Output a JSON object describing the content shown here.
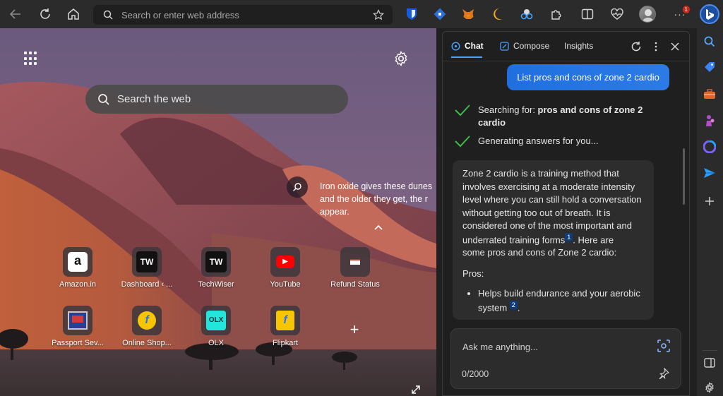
{
  "toolbar": {
    "address_placeholder": "Search or enter web address",
    "notification_count": "1"
  },
  "ntp": {
    "search_placeholder": "Search the web",
    "info_text": [
      "Iron oxide gives these dunes",
      "and the older they get, the r",
      "appear."
    ],
    "tiles": [
      {
        "label": "Amazon.in",
        "icon": "amazon-icon",
        "glyph": "a"
      },
      {
        "label": "Dashboard ‹ ...",
        "icon": "techwiser-icon",
        "glyph": "TW"
      },
      {
        "label": "TechWiser",
        "icon": "techwiser-icon",
        "glyph": "TW"
      },
      {
        "label": "YouTube",
        "icon": "youtube-icon",
        "glyph": "▶"
      },
      {
        "label": "Refund Status",
        "icon": "refund-icon",
        "glyph": ""
      },
      {
        "label": "Passport Sev...",
        "icon": "passport-icon",
        "glyph": ""
      },
      {
        "label": "Online Shop...",
        "icon": "flipkart-icon",
        "glyph": "f"
      },
      {
        "label": "OLX",
        "icon": "olx-icon",
        "glyph": "OLX"
      },
      {
        "label": "Flipkart",
        "icon": "flipkart-icon",
        "glyph": "f"
      }
    ]
  },
  "chat": {
    "tabs": {
      "chat": "Chat",
      "compose": "Compose",
      "insights": "Insights"
    },
    "user_message": "List pros and cons of zone 2 cardio",
    "status": {
      "searching_prefix": "Searching for: ",
      "searching_query_line1": "pros and cons of zone 2",
      "searching_query_line2": "cardio",
      "generating": "Generating answers for you..."
    },
    "answer": {
      "line1": "Zone 2 cardio is a training method that",
      "line2": "involves exercising at a moderate intensity",
      "line3": "level where you can still hold a conversation",
      "line4": "without getting too out of breath. It is",
      "line5": "considered one of the most important and",
      "line6": "underrated training forms",
      "cite1": "1",
      "line6b": ". Here are",
      "line7": "some pros and cons of Zone 2 cardio:",
      "pros_heading": "Pros:",
      "bullet1_line1": "Helps build endurance and your aerobic",
      "bullet1_line2": "system",
      "cite2": "2",
      "bullet1_end": "."
    },
    "composer": {
      "placeholder": "Ask me anything...",
      "char_count": "0/2000"
    }
  },
  "colors": {
    "accent": "#2c7be5",
    "check": "#3dbb4a"
  }
}
